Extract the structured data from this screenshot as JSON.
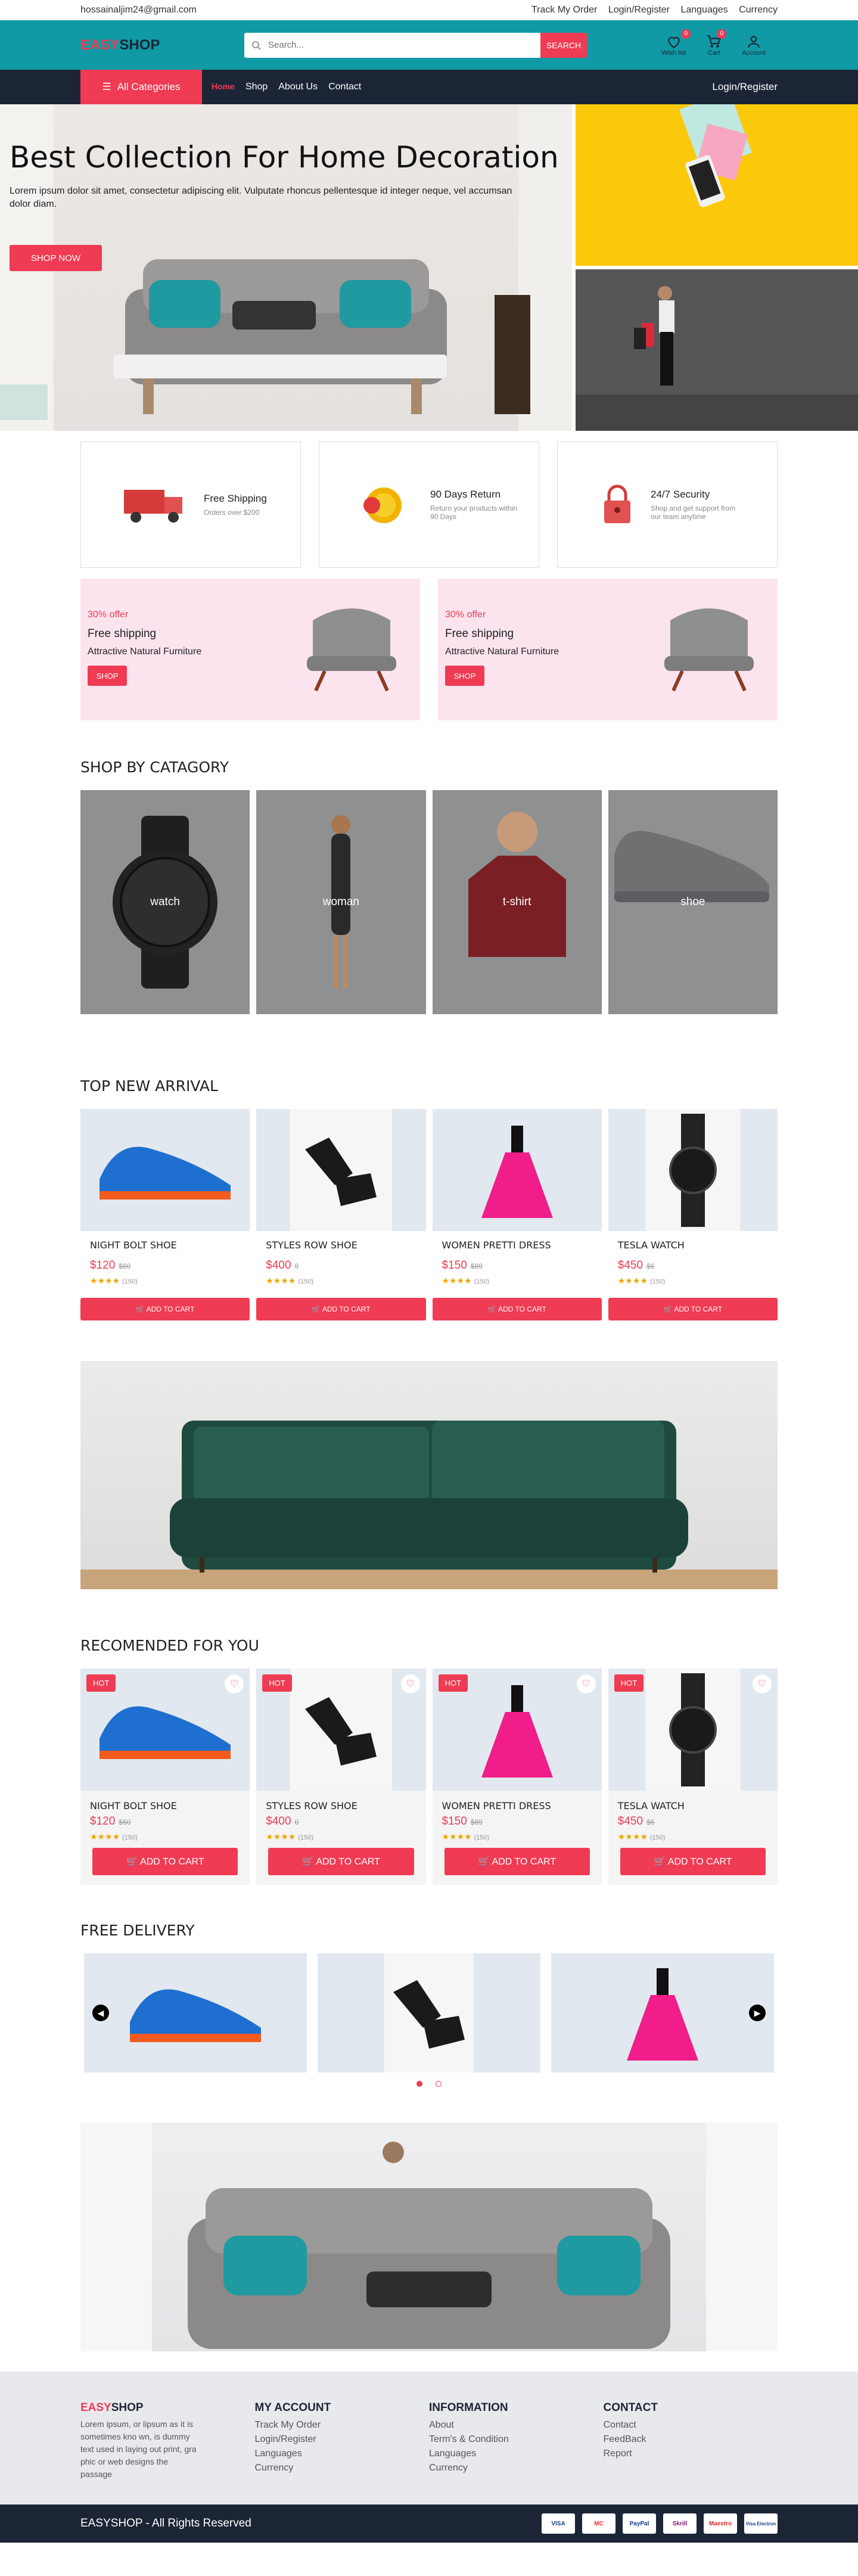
{
  "topbar": {
    "email": "hossainaljim24@gmail.com",
    "links": [
      "Track My Order",
      "Login/Register",
      "Languages",
      "Currency"
    ]
  },
  "header": {
    "logo_a": "EASY",
    "logo_b": "SHOP",
    "search_placeholder": "Search...",
    "search_button": "SEARCH",
    "wishlist_label": "Wish list",
    "wishlist_count": "0",
    "cart_label": "Cart",
    "cart_count": "0",
    "account_label": "Account"
  },
  "nav": {
    "all_categories": "All Categories",
    "links": [
      "Home",
      "Shop",
      "About Us",
      "Contact"
    ],
    "login": "Login/Register"
  },
  "hero": {
    "title": "Best Collection For Home Decoration",
    "text": "Lorem ipsum dolor sit amet, consectetur adipiscing elit. Vulputate rhoncus pellentesque id integer neque, vel accumsan dolor diam.",
    "button": "SHOP NOW"
  },
  "features": [
    {
      "title": "Free Shipping",
      "text": "Orders over $200",
      "icon": "truck-icon"
    },
    {
      "title": "90 Days Return",
      "text": "Return your products within 90 Days",
      "icon": "coin-icon"
    },
    {
      "title": "24/7 Security",
      "text": "Shop and get support from our team anytime",
      "icon": "lock-icon"
    }
  ],
  "offers": [
    {
      "pct": "30% offer",
      "title": "Free shipping",
      "sub": "Attractive Natural Furniture",
      "button": "SHOP"
    },
    {
      "pct": "30% offer",
      "title": "Free shipping",
      "sub": "Attractive Natural Furniture",
      "button": "SHOP"
    }
  ],
  "categories": {
    "title": "SHOP BY CATAGORY",
    "items": [
      "watch",
      "woman",
      "t-shirt",
      "shoe"
    ]
  },
  "new_arrival": {
    "title": "TOP NEW ARRIVAL",
    "button": "ADD TO CART",
    "products": [
      {
        "name": "NIGHT BOLT SHOE",
        "price": "$120",
        "old": "$60",
        "reviews": "(150)"
      },
      {
        "name": "STYLES ROW SHOE",
        "price": "$400",
        "old": "0",
        "reviews": "(150)"
      },
      {
        "name": "WOMEN PRETTI DRESS",
        "price": "$150",
        "old": "$89",
        "reviews": "(150)"
      },
      {
        "name": "TESLA WATCH",
        "price": "$450",
        "old": "$6",
        "reviews": "(150)"
      }
    ]
  },
  "recommended": {
    "title": "RECOMENDED FOR YOU",
    "hot": "HOT",
    "button": "ADD TO CART",
    "products": [
      {
        "name": "NIGHT BOLT SHOE",
        "price": "$120",
        "old": "$60",
        "reviews": "(150)"
      },
      {
        "name": "STYLES ROW SHOE",
        "price": "$400",
        "old": "0",
        "reviews": "(150)"
      },
      {
        "name": "WOMEN PRETTI DRESS",
        "price": "$150",
        "old": "$89",
        "reviews": "(150)"
      },
      {
        "name": "TESLA WATCH",
        "price": "$450",
        "old": "$6",
        "reviews": "(150)"
      }
    ]
  },
  "free_delivery": {
    "title": "FREE DELIVERY"
  },
  "footer": {
    "brand_a": "EASY",
    "brand_b": "SHOP",
    "desc": "Lorem ipsum, or lipsum as it is sometimes kno wn, is dummy text used in laying out print, gra phic or web designs the passage",
    "account": {
      "title": "MY ACCOUNT",
      "items": [
        "Track My Order",
        "Login/Register",
        "Languages",
        "Currency"
      ]
    },
    "info": {
      "title": "INFORMATION",
      "items": [
        "About",
        "Term's & Condition",
        "Languages",
        "Currency"
      ]
    },
    "contact": {
      "title": "CONTACT",
      "items": [
        "Contact",
        "FeedBack",
        "Report"
      ]
    },
    "copyright": "EASYSHOP - All Rights Reserved",
    "payments": [
      "VISA",
      "MC",
      "PayPal",
      "Skrill",
      "Maestro",
      "Visa Electron"
    ]
  },
  "colors": {
    "accent": "#ef3b53",
    "teal": "#0f9aa5",
    "navy": "#1c2536"
  }
}
